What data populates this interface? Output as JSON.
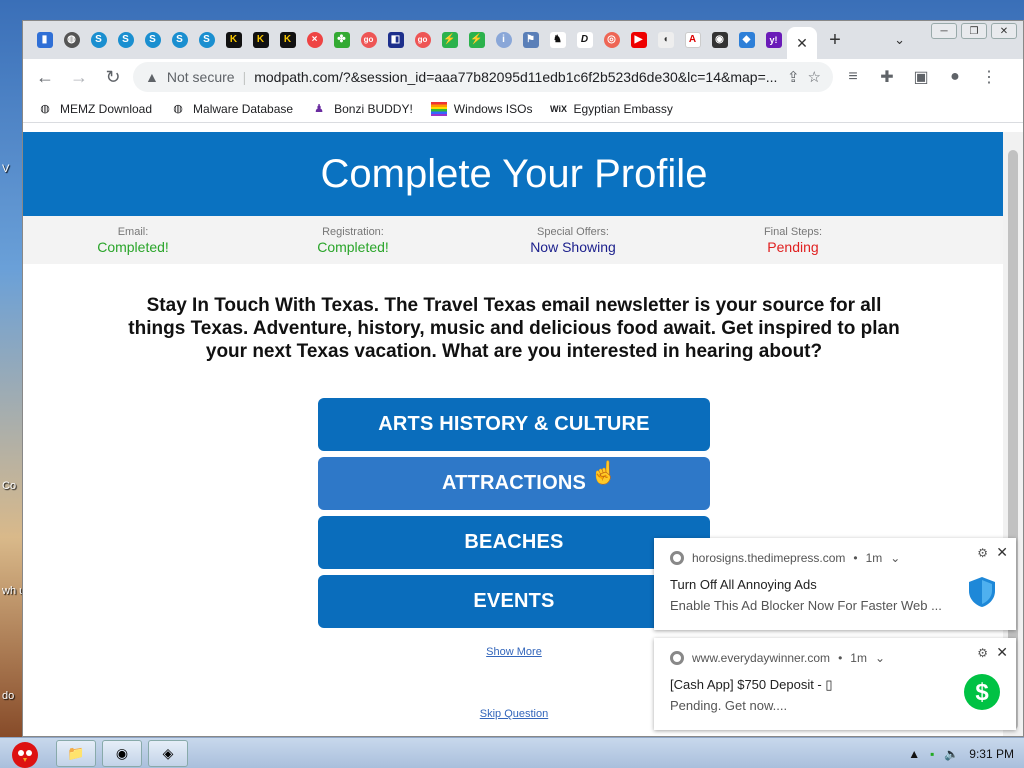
{
  "desktop": {
    "labels": [
      "V",
      "Co",
      "wh\nu",
      "do"
    ]
  },
  "browser": {
    "tab_close": "✕",
    "new_tab": "+",
    "tab_list": "⌄",
    "address": {
      "security": "Not secure",
      "url": "modpath.com/?&session_id=aaa77b82095d11edb1c6f2b523d6de30&lc=14&map=..."
    },
    "bookmarks": [
      {
        "label": "MEMZ Download",
        "icon": "globe-icon"
      },
      {
        "label": "Malware Database",
        "icon": "globe-icon"
      },
      {
        "label": "Bonzi BUDDY!",
        "icon": "bonzi-icon"
      },
      {
        "label": "Windows ISOs",
        "icon": "rainbow-flag-icon"
      },
      {
        "label": "Egyptian Embassy",
        "icon": "wix-icon"
      }
    ]
  },
  "page": {
    "title": "Complete Your Profile",
    "steps": [
      {
        "label": "Email:",
        "status": "Completed!",
        "color": "#2aa52a"
      },
      {
        "label": "Registration:",
        "status": "Completed!",
        "color": "#2aa52a"
      },
      {
        "label": "Special Offers:",
        "status": "Now Showing",
        "color": "#1b1f8c"
      },
      {
        "label": "Final Steps:",
        "status": "Pending",
        "color": "#e02020"
      }
    ],
    "intro": "Stay In Touch With Texas. The Travel Texas email newsletter is your source for all things Texas. Adventure, history, music and delicious food await. Get inspired to plan your next Texas vacation. What are you interested in hearing about?",
    "options": [
      "ARTS HISTORY & CULTURE",
      "ATTRACTIONS",
      "BEACHES",
      "EVENTS"
    ],
    "show_more": "Show More",
    "skip": "Skip Question"
  },
  "notifications": [
    {
      "source": "horosigns.thedimepress.com",
      "age": "1m",
      "title": "Turn Off All Annoying Ads",
      "body": "Enable This Ad Blocker Now For Faster Web ...",
      "image": "shield-icon"
    },
    {
      "source": "www.everydaywinner.com",
      "age": "1m",
      "title": "[Cash App] $750 Deposit - ▯",
      "body": "Pending. Get now....",
      "image": "cash-app-icon"
    }
  ],
  "taskbar": {
    "clock": "9:31 PM"
  },
  "colors": {
    "brand": "#0a72c1",
    "button": "#0a6dbc"
  }
}
